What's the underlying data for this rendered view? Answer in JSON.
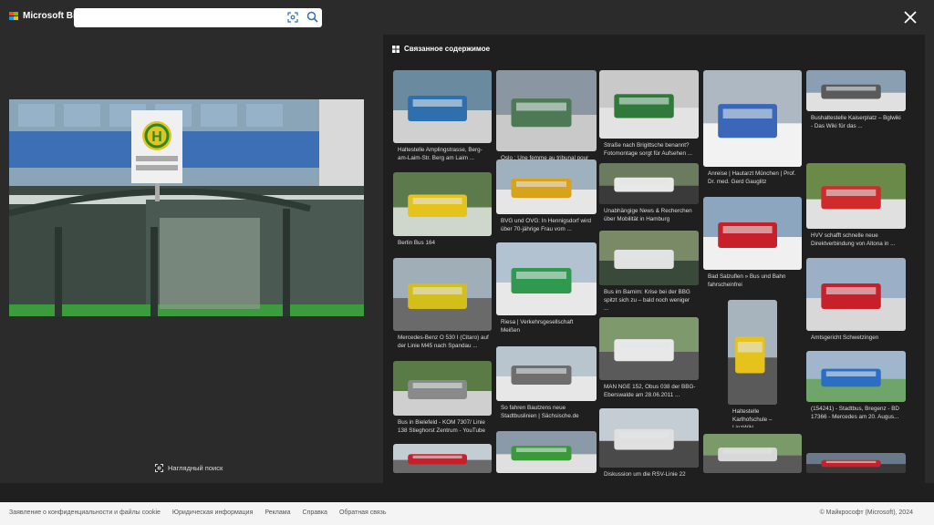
{
  "brand": {
    "name": "Microsoft Bing"
  },
  "search": {
    "value": "",
    "placeholder": ""
  },
  "related": {
    "title": "Связанное содержимое"
  },
  "visual_search": {
    "label": "Наглядный поиск"
  },
  "tiles": [
    {
      "caption": "Haltestelle Amplingstrasse, Berg-am-Laim-Str. Berg am Laim ..."
    },
    {
      "caption": "Oslo : Une femme au tribunal pour avoir fait pipi dans le tram ..."
    },
    {
      "caption": "Straße nach Brigittsche benannt? Fotomontage sorgt für Aufsehen ..."
    },
    {
      "caption": "Anreise | Hautarzt München | Prof. Dr. med. Gerd Gauglitz"
    },
    {
      "caption": "Bushaltestelle Kaiserplatz – Bglwiki - Das Wiki für das ..."
    },
    {
      "caption": "Berlin Bus 164"
    },
    {
      "caption": "BVG und OVG: In Hennigsdorf wird über 70-jährige Frau vom ..."
    },
    {
      "caption": "Unabhängige News & Recherchen über Mobilität in Hamburg"
    },
    {
      "caption": "Bad Salzuflen » Bus und Bahn fahrscheinfrei"
    },
    {
      "caption": "HVV schafft schnelle neue Direktverbindung von Altona in ..."
    },
    {
      "caption": "Mercedes-Benz O 530 I (Citaro) auf der Linie M45 nach Spandau ..."
    },
    {
      "caption": "Riesa | Verkehrsgesellschaft Meißen"
    },
    {
      "caption": "Bus im Barnim: Krise bei der BBG spitzt sich zu – bald noch weniger ..."
    },
    {
      "caption": "Amtsgericht Schwetzingen"
    },
    {
      "caption": "Bus in Bielefeld - KOM 7307/ Linie 138 Stieghorst Zentrum - YouTube"
    },
    {
      "caption": "So fahren Bautzens neue Stadtbuslinien | Sächsische.de"
    },
    {
      "caption": "MAN NGE 152, Obus 038 der BBG-Eberswalde am 28.06.2011 ..."
    },
    {
      "caption": "Haltestelle Karlhofschule – LinzWiki"
    },
    {
      "caption": "(154241) - Stadtbus, Bregenz - BD 17366 - Mercedes am 20. Augus..."
    },
    {
      "caption": "Diskussion um die RSV-Linie 22"
    }
  ],
  "footer": {
    "links": [
      "Заявление о конфиденциальности и файлы cookie",
      "Юридическая информация",
      "Реклама",
      "Справка",
      "Обратная связь"
    ],
    "copyright": "© Майкрософт (Microsoft), 2024"
  },
  "icons": {
    "close": "close-icon",
    "camera": "visual-search-camera-icon",
    "search": "search-icon",
    "grid": "related-grid-icon"
  },
  "colors": {
    "background": "#2b2b2b",
    "panel": "#1f1f1f",
    "ms_red": "#f25022",
    "ms_green": "#7fba00",
    "ms_blue": "#00a4ef",
    "ms_yellow": "#ffb900"
  }
}
